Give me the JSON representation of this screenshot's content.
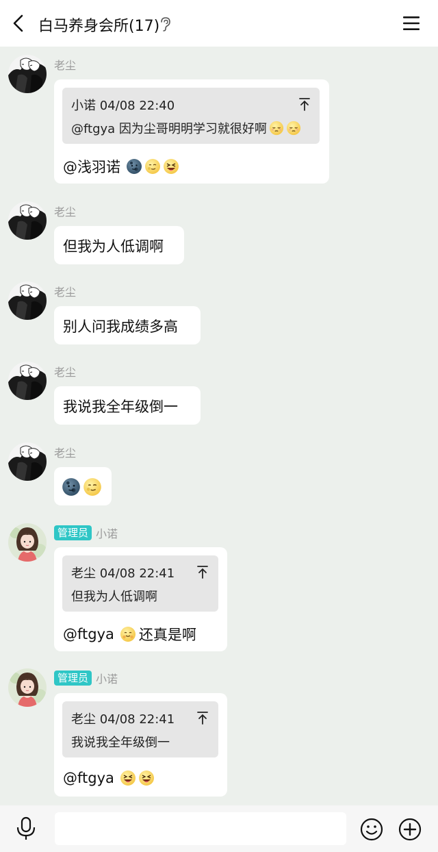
{
  "header": {
    "title": "白马养身会所(17)",
    "back_icon": "back-arrow-icon",
    "ear_icon": "ear-icon",
    "menu_icon": "menu-icon"
  },
  "messages": [
    {
      "sender": "老尘",
      "quote_head": "小诺 04/08 22:40",
      "quote_body": "@ftgya 因为尘哥明明学习就很好啊",
      "text": "@浅羽诺",
      "emojis": [
        "new-moon-face",
        "full-moon-face",
        "laughing-face"
      ]
    },
    {
      "sender": "老尘",
      "text": "但我为人低调啊"
    },
    {
      "sender": "老尘",
      "text": "别人问我成绩多高"
    },
    {
      "sender": "老尘",
      "text": "我说我全年级倒一"
    },
    {
      "sender": "老尘",
      "text": "",
      "emojis": [
        "new-moon-face",
        "full-moon-face"
      ]
    },
    {
      "badge": "管理员",
      "sender": "小诺",
      "quote_head": "老尘 04/08 22:41",
      "quote_body": "但我为人低调啊",
      "text": "@ftgya",
      "text_after": "还真是啊"
    },
    {
      "badge": "管理员",
      "sender": "小诺",
      "quote_head": "老尘 04/08 22:41",
      "quote_body": "我说我全年级倒一",
      "text": "@ftgya"
    }
  ],
  "footer": {
    "input_placeholder": "",
    "mic_icon": "microphone-icon",
    "emoji_icon": "emoji-icon",
    "plus_icon": "plus-icon"
  },
  "colors": {
    "background": "#ecf0ec",
    "badge": "#2fc6c6",
    "quote_bg": "#e6e6e6"
  }
}
